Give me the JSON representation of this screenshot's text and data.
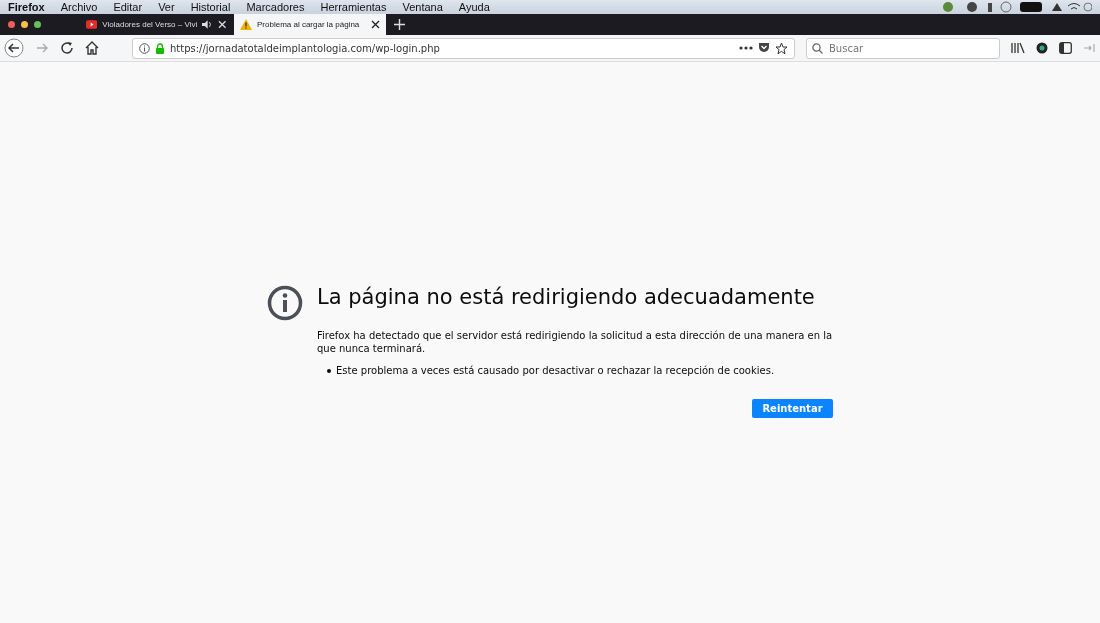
{
  "menu_bar": {
    "app": "Firefox",
    "items": [
      "Archivo",
      "Editar",
      "Ver",
      "Historial",
      "Marcadores",
      "Herramientas",
      "Ventana",
      "Ayuda"
    ]
  },
  "tabs": [
    {
      "label": "Violadores del Verso – Vivi",
      "selected": false,
      "kind": "media"
    },
    {
      "label": "Problema al cargar la página",
      "selected": true,
      "kind": "warning"
    }
  ],
  "url": "https://jornadatotaldeimplantologia.com/wp-login.php",
  "search": {
    "placeholder": "Buscar"
  },
  "error": {
    "title": "La página no está redirigiendo adecuadamente",
    "description": "Firefox ha detectado que el servidor está redirigiendo la solicitud a esta dirección de una manera en la que nunca terminará.",
    "bullets": [
      "Este problema a veces está causado por desactivar o rechazar la recepción de cookies."
    ],
    "button": "Reintentar"
  }
}
